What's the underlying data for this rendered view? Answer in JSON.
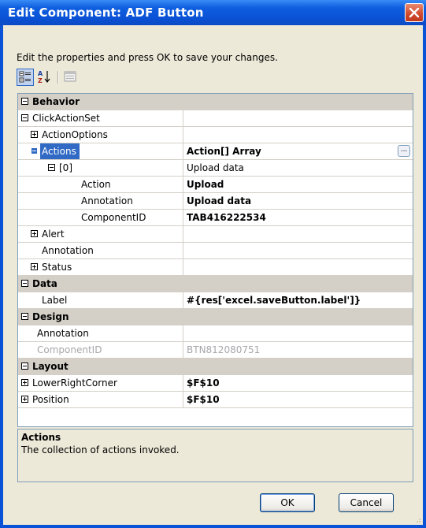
{
  "window": {
    "title": "Edit Component: ADF Button"
  },
  "instructions": "Edit the properties and press OK to save your changes.",
  "toolbar": {
    "categorized_icon": "categorized-icon",
    "alphabetical_icon": "alphabetical-sort-icon",
    "property_pages_icon": "property-pages-icon"
  },
  "grid": {
    "rows": [
      {
        "name": "Behavior",
        "value": "",
        "type": "category",
        "expander": "minus"
      },
      {
        "name": "ClickActionSet",
        "value": "",
        "expander": "minus"
      },
      {
        "name": "ActionOptions",
        "value": "",
        "expander": "plus"
      },
      {
        "name": "Actions",
        "value": "Action[] Array",
        "expander": "minus",
        "selected": true,
        "value_bold": true,
        "has_ellipsis": true
      },
      {
        "name": "[0]",
        "value": "Upload data",
        "expander": "minus"
      },
      {
        "name": "Action",
        "value": "Upload",
        "value_bold": true
      },
      {
        "name": "Annotation",
        "value": "Upload data",
        "value_bold": true
      },
      {
        "name": "ComponentID",
        "value": "TAB416222534",
        "value_bold": true
      },
      {
        "name": "Alert",
        "value": "",
        "expander": "plus"
      },
      {
        "name": "Annotation",
        "value": ""
      },
      {
        "name": "Status",
        "value": "",
        "expander": "plus"
      },
      {
        "name": "Data",
        "value": "",
        "type": "category",
        "expander": "minus"
      },
      {
        "name": "Label",
        "value": "#{res['excel.saveButton.label']}",
        "value_bold": true
      },
      {
        "name": "Design",
        "value": "",
        "type": "category",
        "expander": "minus"
      },
      {
        "name": "Annotation",
        "value": ""
      },
      {
        "name": "ComponentID",
        "value": "BTN812080751",
        "disabled": true
      },
      {
        "name": "Layout",
        "value": "",
        "type": "category",
        "expander": "minus"
      },
      {
        "name": "LowerRightCorner",
        "value": "$F$10",
        "expander": "plus",
        "value_bold": true
      },
      {
        "name": "Position",
        "value": "$F$10",
        "expander": "plus",
        "value_bold": true
      }
    ],
    "ellipsis_label": "..."
  },
  "description": {
    "title": "Actions",
    "text": "The collection of actions invoked."
  },
  "buttons": {
    "ok": "OK",
    "cancel": "Cancel"
  },
  "colors": {
    "title_bar": "#0a52d6",
    "selection": "#316ac5",
    "category_bg": "#d4d0c8",
    "dialog_bg": "#ece9d8"
  }
}
